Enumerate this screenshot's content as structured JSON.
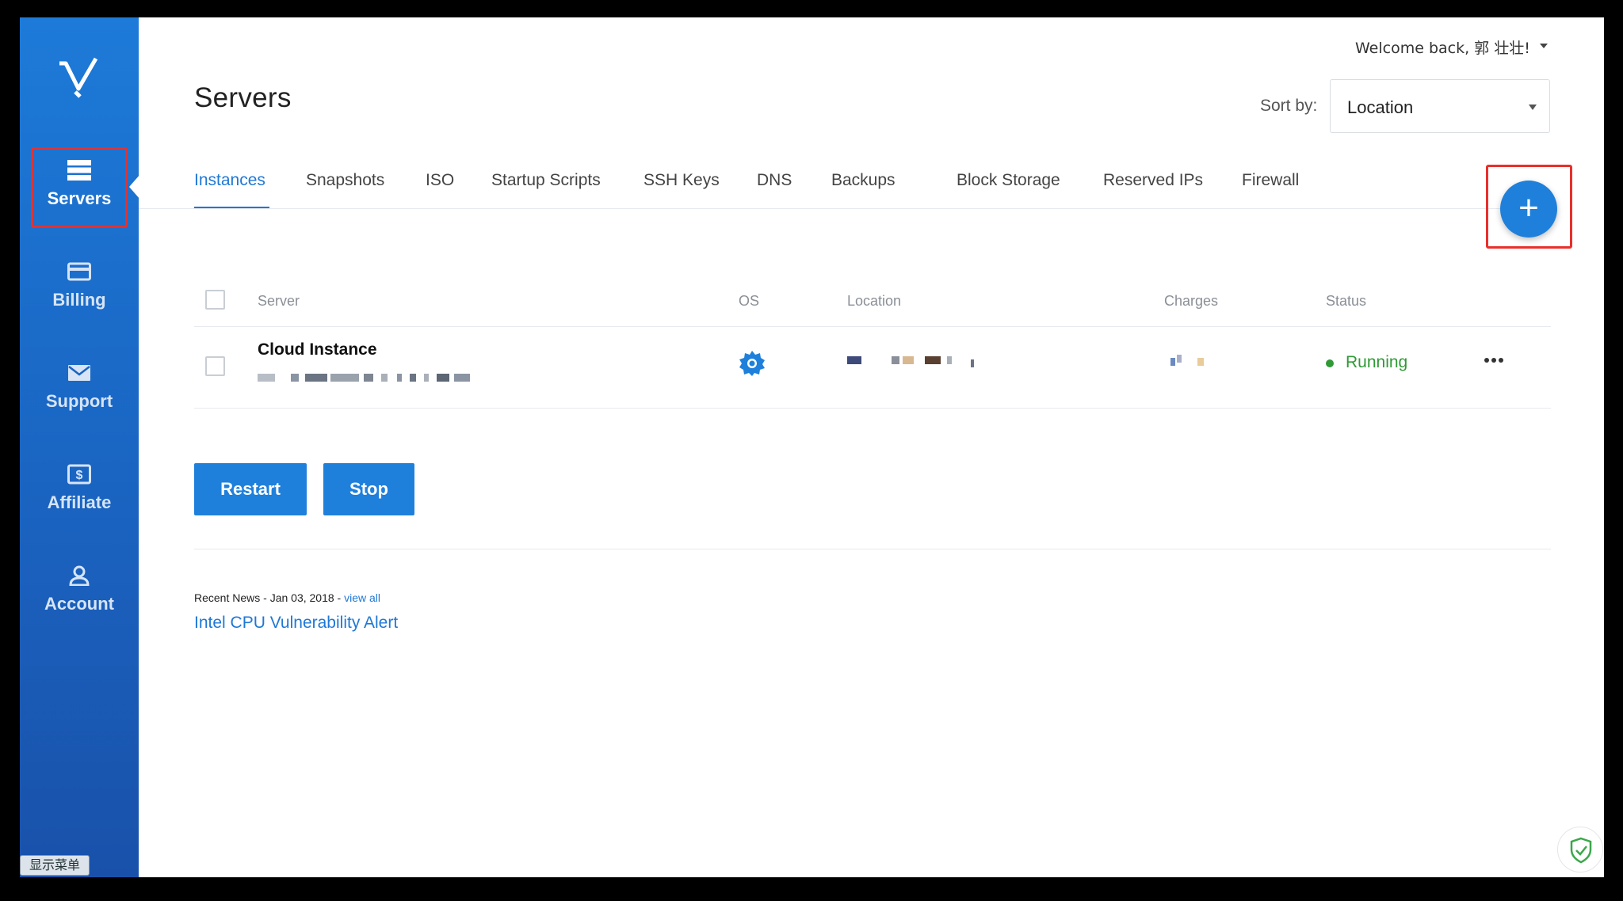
{
  "sidebar": {
    "items": [
      {
        "label": "Servers",
        "icon": "server-icon",
        "active": true
      },
      {
        "label": "Billing",
        "icon": "credit-card-icon"
      },
      {
        "label": "Support",
        "icon": "envelope-icon"
      },
      {
        "label": "Affiliate",
        "icon": "dollar-icon"
      },
      {
        "label": "Account",
        "icon": "user-icon"
      }
    ],
    "menu_tag": "显示菜单"
  },
  "header": {
    "welcome": "Welcome back, 郭 壮壮!",
    "page_title": "Servers",
    "sort_label": "Sort by:",
    "sort_value": "Location"
  },
  "tabs": [
    "Instances",
    "Snapshots",
    "ISO",
    "Startup Scripts",
    "SSH Keys",
    "DNS",
    "Backups",
    "Block Storage",
    "Reserved IPs",
    "Firewall"
  ],
  "add_button": "+",
  "table": {
    "columns": [
      "Server",
      "OS",
      "Location",
      "Charges",
      "Status"
    ],
    "rows": [
      {
        "server": "Cloud Instance",
        "status": "Running"
      }
    ]
  },
  "actions": {
    "restart": "Restart",
    "stop": "Stop"
  },
  "news": {
    "prefix": "Recent News - Jan 03, 2018 - ",
    "view_all": "view all",
    "title": "Intel CPU Vulnerability Alert"
  },
  "colors": {
    "accent": "#1f80dc",
    "sidebar": "#1a64c1",
    "running": "#2f9a36",
    "highlight": "#e8302c"
  }
}
